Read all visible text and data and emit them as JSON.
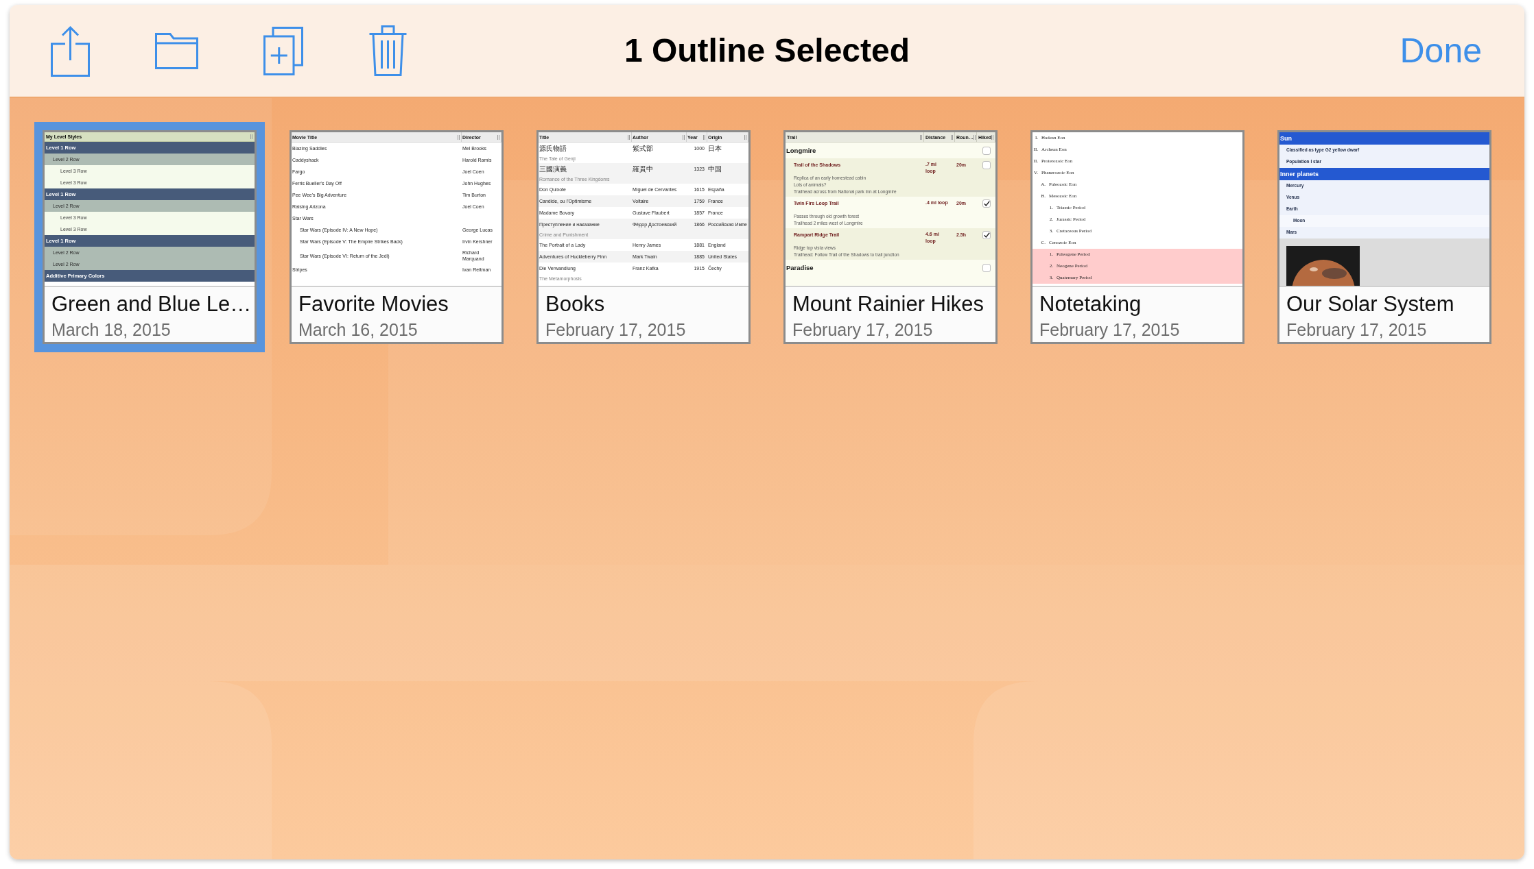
{
  "toolbar": {
    "buttons": [
      {
        "kind": "share"
      },
      {
        "kind": "folder"
      },
      {
        "kind": "duplicate"
      },
      {
        "kind": "trash"
      }
    ],
    "title": "1 Outline Selected",
    "done": "Done"
  },
  "documents": [
    {
      "title": "Green and Blue Le…",
      "date": "March 18, 2015",
      "selected": true,
      "preview": {
        "kind": "levels",
        "header": "My Level Styles",
        "rows": [
          {
            "text": "Level 1 Row",
            "children": [
              {
                "text": "Level 2 Row",
                "children": [
                  {
                    "text": "Level 3 Row"
                  },
                  {
                    "text": "Level 3 Row"
                  }
                ]
              }
            ]
          },
          {
            "text": "Level 1 Row",
            "children": [
              {
                "text": "Level 2 Row",
                "children": [
                  {
                    "text": "Level 3 Row"
                  },
                  {
                    "text": "Level 3 Row"
                  }
                ]
              }
            ]
          },
          {
            "text": "Level 1 Row",
            "children": [
              {
                "text": "Level 2 Row"
              },
              {
                "text": "Level 2 Row"
              }
            ]
          },
          {
            "text": "Additive Primary Colors"
          }
        ]
      }
    },
    {
      "title": "Favorite Movies",
      "date": "March 16, 2015",
      "selected": false,
      "preview": {
        "kind": "table",
        "columns": [
          "Movie Title",
          "Director"
        ],
        "rows": [
          {
            "cells": [
              "Blazing Saddles",
              "Mel Brooks"
            ]
          },
          {
            "cells": [
              "Caddyshack",
              "Harold Ramis"
            ]
          },
          {
            "cells": [
              "Fargo",
              "Joel Coen"
            ]
          },
          {
            "cells": [
              "Ferris Bueller's Day Off",
              "John Hughes"
            ]
          },
          {
            "cells": [
              "Pee Wee's Big Adventure",
              "Tim Burton"
            ]
          },
          {
            "cells": [
              "Raising Arizona",
              "Joel Coen"
            ]
          },
          {
            "cells": [
              "Star Wars"
            ],
            "children": [
              {
                "cells": [
                  "Star Wars (Episode IV: A New Hope)",
                  "George Lucas"
                ]
              },
              {
                "cells": [
                  "Star Wars (Episode V: The Empire Strikes Back)",
                  "Irvin Kershner"
                ]
              },
              {
                "cells": [
                  "Star Wars (Episode VI: Return of the Jedi)",
                  "Richard Marquand"
                ]
              }
            ]
          },
          {
            "cells": [
              "Stripes",
              "Ivan Reitman"
            ]
          }
        ]
      }
    },
    {
      "title": "Books",
      "date": "February 17, 2015",
      "selected": false,
      "preview": {
        "kind": "table",
        "striped": true,
        "columns": [
          "Title",
          "Author",
          "Year",
          "Origin"
        ],
        "rows": [
          {
            "cells": [
              "源氏物語",
              "紫式部",
              "1000",
              "日本"
            ],
            "note": "The Tale of Genji"
          },
          {
            "cells": [
              "三國演義",
              "羅貫中",
              "1323",
              "中国"
            ],
            "note": "Romance of the Three Kingdoms"
          },
          {
            "cells": [
              "Don Quixote",
              "Miguel de Cervantes",
              "1615",
              "España"
            ]
          },
          {
            "cells": [
              "Candide, ou l'Optimisme",
              "Voltaire",
              "1759",
              "France"
            ]
          },
          {
            "cells": [
              "Madame Bovary",
              "Gustave Flaubert",
              "1857",
              "France"
            ]
          },
          {
            "cells": [
              "Преступление и наказание",
              "Фёдор Достоевский",
              "1866",
              "Российская Импе"
            ],
            "note": "Crime and Punishment"
          },
          {
            "cells": [
              "The Portrait of a Lady",
              "Henry James",
              "1881",
              "England"
            ]
          },
          {
            "cells": [
              "Adventures of Huckleberry Finn",
              "Mark Twain",
              "1885",
              "United States"
            ]
          },
          {
            "cells": [
              "Die Verwandlung",
              "Franz Kafka",
              "1915",
              "Čechy"
            ],
            "note": "The Metamorphosis"
          }
        ]
      }
    },
    {
      "title": "Mount Rainier Hikes",
      "date": "February 17, 2015",
      "selected": false,
      "preview": {
        "kind": "hikes",
        "columns": [
          "Trail",
          "Distance",
          "Roun…",
          "Hiked"
        ],
        "rows": [
          {
            "name": "Longmire",
            "checked": false,
            "children": [
              {
                "name": "Trail of the Shadows",
                "distance": ".7 mi\nloop",
                "time": "20m",
                "checked": false,
                "notes": [
                  "Replica of an early homestead cabin",
                  "Lots of animals?",
                  "Trailhead across from National park Inn at Longmire"
                ]
              },
              {
                "name": "Twin Firs Loop Trail",
                "distance": ".4 mi loop",
                "time": "20m",
                "checked": true,
                "notes": [
                  "Passes through old growth forest",
                  "Trailhead 2 miles west of Longmire"
                ]
              },
              {
                "name": "Rampart Ridge Trail",
                "distance": "4.6 mi\nloop",
                "time": "2.5h",
                "checked": true,
                "notes": [
                  "Ridge top vista views",
                  "Trailhead: Follow Trail of the Shadows to trail junction"
                ]
              }
            ]
          },
          {
            "name": "Paradise",
            "checked": false
          }
        ]
      }
    },
    {
      "title": "Notetaking",
      "date": "February 17, 2015",
      "selected": false,
      "preview": {
        "kind": "outline",
        "items": [
          {
            "marker": "I.",
            "text": "Hadean Eon",
            "highlighted": false
          },
          {
            "marker": "II.",
            "text": "Archean Eon",
            "highlighted": false
          },
          {
            "marker": "II.",
            "text": "Proterozoic Eon",
            "highlighted": false
          },
          {
            "marker": "V.",
            "text": "Phanerozoic Eon",
            "highlighted": false,
            "children": [
              {
                "marker": "A.",
                "text": "Paleozoic Eon",
                "highlighted": false
              },
              {
                "marker": "B.",
                "text": "Mesozoic Eon",
                "highlighted": false,
                "children": [
                  {
                    "marker": "1.",
                    "text": "Triassic Period",
                    "highlighted": false
                  },
                  {
                    "marker": "2.",
                    "text": "Jurassic Period",
                    "highlighted": false
                  },
                  {
                    "marker": "3.",
                    "text": "Cretaceous Period",
                    "highlighted": false
                  }
                ]
              },
              {
                "marker": "C.",
                "text": "Cenozoic Eon",
                "highlighted": false,
                "children": [
                  {
                    "marker": "1.",
                    "text": "Paleogene Period",
                    "highlighted": true
                  },
                  {
                    "marker": "2.",
                    "text": "Neogene Period",
                    "highlighted": true
                  },
                  {
                    "marker": "3.",
                    "text": "Quaternary Period",
                    "highlighted": true
                  }
                ]
              }
            ]
          }
        ]
      }
    },
    {
      "title": "Our Solar System",
      "date": "February 17, 2015",
      "selected": false,
      "preview": {
        "kind": "topics",
        "photo": true,
        "rows": [
          {
            "text": "Sun",
            "children": [
              {
                "text": "Classified as type G2 yellow dwarf"
              },
              {
                "text": "Population I star"
              }
            ]
          },
          {
            "text": "Inner planets",
            "children": [
              {
                "text": "Mercury"
              },
              {
                "text": "Venus"
              },
              {
                "text": "Earth",
                "children": [
                  {
                    "text": "Moon"
                  }
                ]
              },
              {
                "text": "Mars"
              }
            ]
          }
        ]
      }
    }
  ]
}
